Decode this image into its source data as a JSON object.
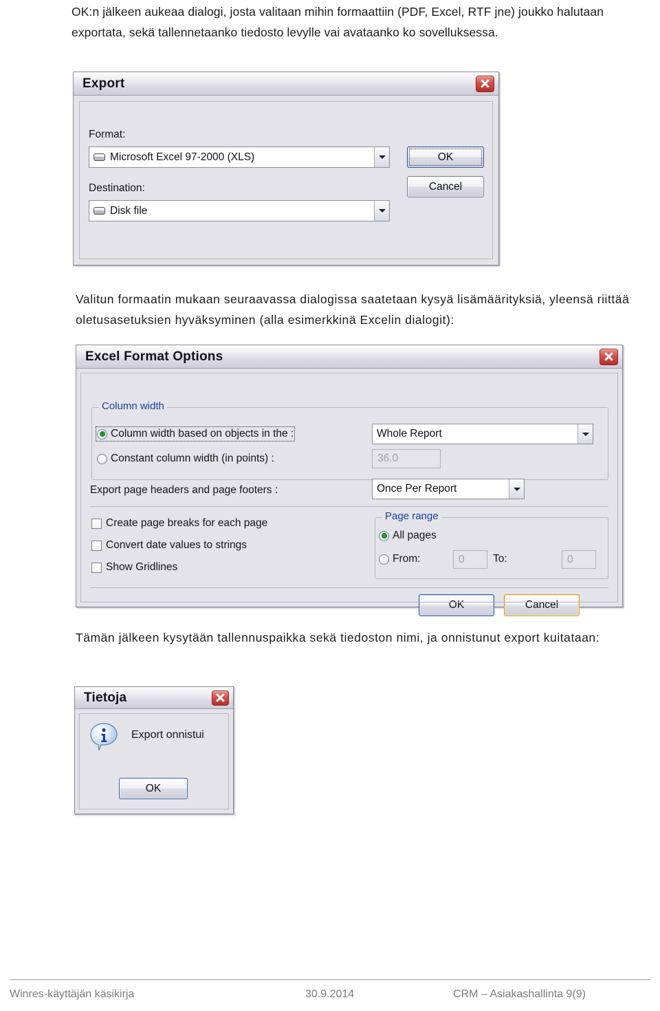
{
  "document": {
    "intro_paragraph": "OK:n jälkeen aukeaa dialogi, josta valitaan mihin formaattiin (PDF, Excel, RTF jne) joukko halutaan exportata, sekä tallennetaanko tiedosto levylle vai avataanko ko sovelluksessa.",
    "middle_paragraph": "Valitun formaatin mukaan seuraavassa dialogissa saatetaan kysyä lisämäärityksiä, yleensä riittää oletusasetuksien hyväksyminen (alla esimerkkinä Excelin dialogit):",
    "after_paragraph": "Tämän jälkeen kysytään tallennuspaikka sekä tiedoston nimi, ja onnistunut export kuitataan:"
  },
  "export_dialog": {
    "title": "Export",
    "close_tooltip": "Close",
    "format_label": "Format:",
    "format_value": "Microsoft Excel 97-2000 (XLS)",
    "destination_label": "Destination:",
    "destination_value": "Disk file",
    "ok_label": "OK",
    "cancel_label": "Cancel"
  },
  "excel_dialog": {
    "title": "Excel Format Options",
    "column_width_group": "Column width",
    "radio_based_on_objects": "Column width based on objects in the :",
    "radio_constant_width": "Constant column width (in points) :",
    "scope_value": "Whole Report",
    "constant_width_value": "36.0",
    "export_headers_label": "Export page headers and page footers :",
    "export_headers_value": "Once Per Report",
    "checkbox_page_breaks": "Create page breaks for each page",
    "checkbox_convert_dates": "Convert date values to strings",
    "checkbox_show_gridlines": "Show Gridlines",
    "page_range_group": "Page range",
    "radio_all_pages": "All pages",
    "radio_from": "From:",
    "from_value": "0",
    "to_label": "To:",
    "to_value": "0",
    "ok_label": "OK",
    "cancel_label": "Cancel"
  },
  "info_dialog": {
    "title": "Tietoja",
    "message": "Export onnistui",
    "ok_label": "OK"
  },
  "footer": {
    "left": "Winres-käyttäjän käsikirja",
    "center": "30.9.2014",
    "right": "CRM – Asiakashallinta  9(9)"
  }
}
